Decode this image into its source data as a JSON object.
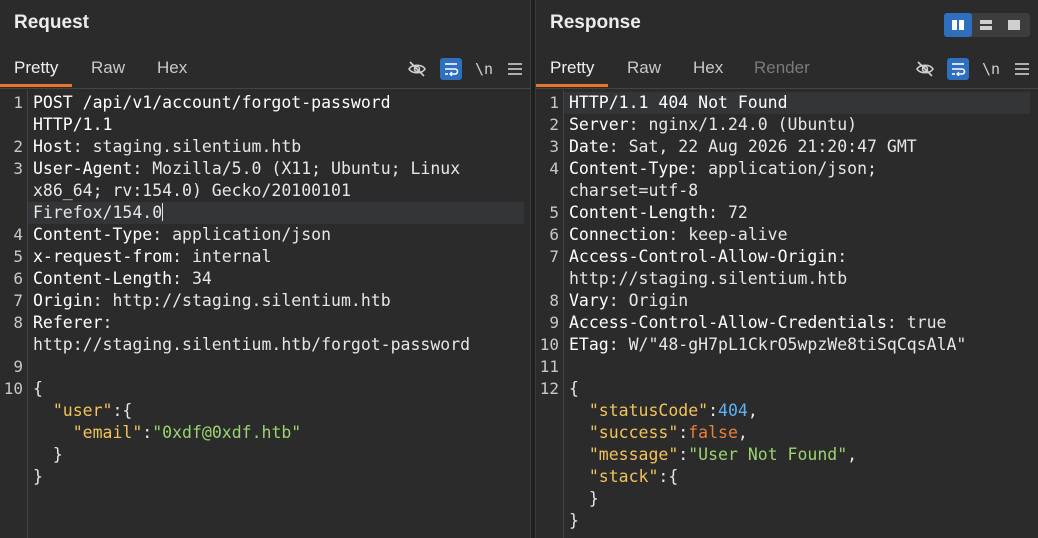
{
  "request": {
    "title": "Request",
    "tabs": [
      "Pretty",
      "Raw",
      "Hex"
    ],
    "toolbar": {
      "newline": "\\n"
    },
    "lines": [
      {
        "n": "1",
        "parts": [
          [
            "hk",
            "POST /api/v1/account/forgot-password"
          ]
        ]
      },
      {
        "n": "",
        "parts": [
          [
            "hk",
            "HTTP/1.1"
          ]
        ]
      },
      {
        "n": "2",
        "parts": [
          [
            "hk",
            "Host"
          ],
          [
            "p",
            ": staging.silentium.htb"
          ]
        ]
      },
      {
        "n": "3",
        "parts": [
          [
            "hk",
            "User-Agent"
          ],
          [
            "p",
            ": Mozilla/5.0 (X11; Ubuntu; Linux"
          ]
        ]
      },
      {
        "n": "",
        "parts": [
          [
            "p",
            "x86_64; rv:154.0) Gecko/20100101"
          ]
        ]
      },
      {
        "n": "",
        "parts": [
          [
            "p",
            "Firefox/154.0"
          ]
        ],
        "cursor": true
      },
      {
        "n": "4",
        "parts": [
          [
            "hk",
            "Content-Type"
          ],
          [
            "p",
            ": application/json"
          ]
        ]
      },
      {
        "n": "5",
        "parts": [
          [
            "hk",
            "x-request-from"
          ],
          [
            "p",
            ": internal"
          ]
        ]
      },
      {
        "n": "6",
        "parts": [
          [
            "hk",
            "Content-Length"
          ],
          [
            "p",
            ": 34"
          ]
        ]
      },
      {
        "n": "7",
        "parts": [
          [
            "hk",
            "Origin"
          ],
          [
            "p",
            ": http://staging.silentium.htb"
          ]
        ]
      },
      {
        "n": "8",
        "parts": [
          [
            "hk",
            "Referer"
          ],
          [
            "p",
            ":"
          ]
        ]
      },
      {
        "n": "",
        "parts": [
          [
            "p",
            "http://staging.silentium.htb/forgot-password"
          ]
        ]
      },
      {
        "n": "9",
        "parts": []
      },
      {
        "n": "10",
        "parts": [
          [
            "p",
            "{"
          ]
        ]
      },
      {
        "n": "",
        "parts": [
          [
            "p",
            "  "
          ],
          [
            "jk",
            "\"user\""
          ],
          [
            "p",
            ":{"
          ]
        ]
      },
      {
        "n": "",
        "parts": [
          [
            "p",
            "    "
          ],
          [
            "jk",
            "\"email\""
          ],
          [
            "p",
            ":"
          ],
          [
            "js",
            "\"0xdf@0xdf.htb\""
          ]
        ]
      },
      {
        "n": "",
        "parts": [
          [
            "p",
            "  }"
          ]
        ]
      },
      {
        "n": "",
        "parts": [
          [
            "p",
            "}"
          ]
        ]
      }
    ]
  },
  "response": {
    "title": "Response",
    "tabs": [
      "Pretty",
      "Raw",
      "Hex",
      "Render"
    ],
    "toolbar": {
      "newline": "\\n"
    },
    "lines": [
      {
        "n": "1",
        "parts": [
          [
            "hk",
            "HTTP/1.1 404 Not Found"
          ]
        ]
      },
      {
        "n": "2",
        "parts": [
          [
            "hk",
            "Server"
          ],
          [
            "p",
            ": nginx/1.24.0 (Ubuntu)"
          ]
        ]
      },
      {
        "n": "3",
        "parts": [
          [
            "hk",
            "Date"
          ],
          [
            "p",
            ": Sat, 22 Aug 2026 21:20:47 GMT"
          ]
        ]
      },
      {
        "n": "4",
        "parts": [
          [
            "hk",
            "Content-Type"
          ],
          [
            "p",
            ": application/json;"
          ]
        ]
      },
      {
        "n": "",
        "parts": [
          [
            "p",
            "charset=utf-8"
          ]
        ]
      },
      {
        "n": "5",
        "parts": [
          [
            "hk",
            "Content-Length"
          ],
          [
            "p",
            ": 72"
          ]
        ]
      },
      {
        "n": "6",
        "parts": [
          [
            "hk",
            "Connection"
          ],
          [
            "p",
            ": keep-alive"
          ]
        ]
      },
      {
        "n": "7",
        "parts": [
          [
            "hk",
            "Access-Control-Allow-Origin"
          ],
          [
            "p",
            ":"
          ]
        ]
      },
      {
        "n": "",
        "parts": [
          [
            "p",
            "http://staging.silentium.htb"
          ]
        ]
      },
      {
        "n": "8",
        "parts": [
          [
            "hk",
            "Vary"
          ],
          [
            "p",
            ": Origin"
          ]
        ]
      },
      {
        "n": "9",
        "parts": [
          [
            "hk",
            "Access-Control-Allow-Credentials"
          ],
          [
            "p",
            ": true"
          ]
        ]
      },
      {
        "n": "10",
        "parts": [
          [
            "hk",
            "ETag"
          ],
          [
            "p",
            ": W/\"48-gH7pL1CkrO5wpzWe8tiSqCqsAlA\""
          ]
        ]
      },
      {
        "n": "11",
        "parts": []
      },
      {
        "n": "12",
        "parts": [
          [
            "p",
            "{"
          ]
        ]
      },
      {
        "n": "",
        "parts": [
          [
            "p",
            "  "
          ],
          [
            "jk",
            "\"statusCode\""
          ],
          [
            "p",
            ":"
          ],
          [
            "jn",
            "404"
          ],
          [
            "p",
            ","
          ]
        ]
      },
      {
        "n": "",
        "parts": [
          [
            "p",
            "  "
          ],
          [
            "jk",
            "\"success\""
          ],
          [
            "p",
            ":"
          ],
          [
            "jb",
            "false"
          ],
          [
            "p",
            ","
          ]
        ]
      },
      {
        "n": "",
        "parts": [
          [
            "p",
            "  "
          ],
          [
            "jk",
            "\"message\""
          ],
          [
            "p",
            ":"
          ],
          [
            "js",
            "\"User Not Found\""
          ],
          [
            "p",
            ","
          ]
        ]
      },
      {
        "n": "",
        "parts": [
          [
            "p",
            "  "
          ],
          [
            "jk",
            "\"stack\""
          ],
          [
            "p",
            ":{"
          ]
        ]
      },
      {
        "n": "",
        "parts": [
          [
            "p",
            "  }"
          ]
        ]
      },
      {
        "n": "",
        "parts": [
          [
            "p",
            "}"
          ]
        ]
      }
    ]
  }
}
